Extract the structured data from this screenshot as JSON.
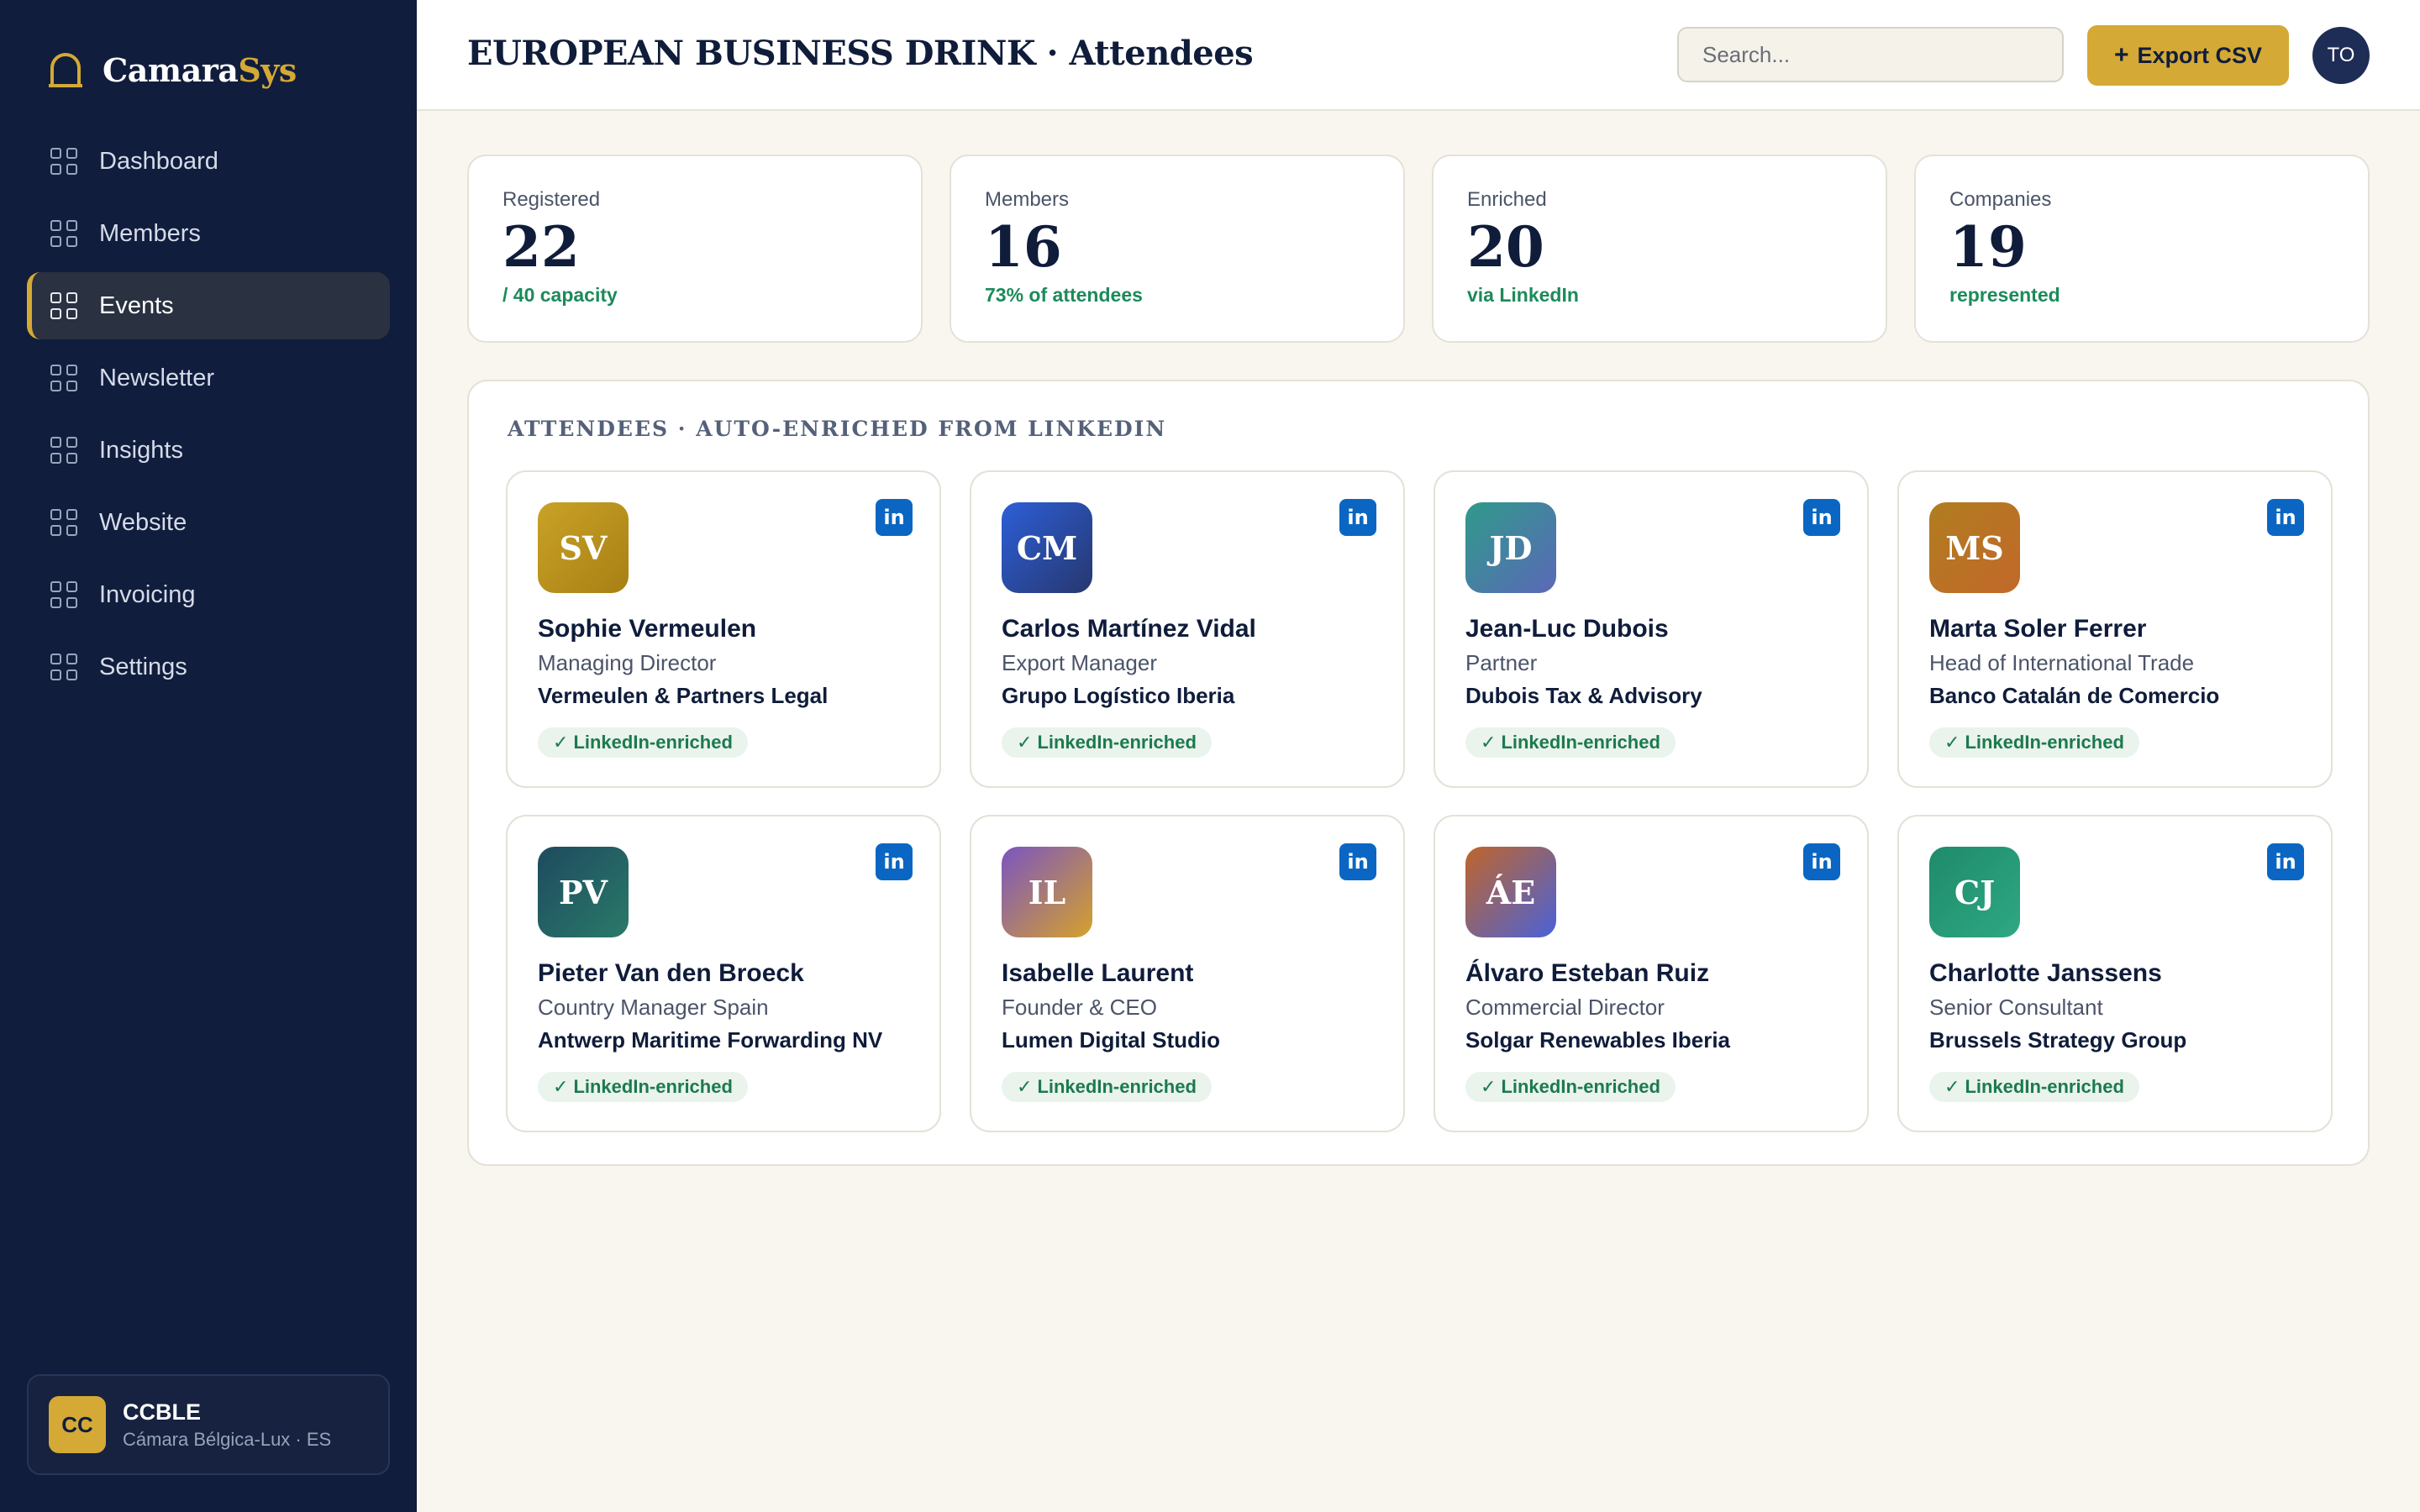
{
  "app": {
    "name_main": "Camara",
    "name_accent": "Sys",
    "logo_icon": "bell-icon",
    "accent_color": "#d4a935",
    "sidebar_color": "#111d3d"
  },
  "sidebar": {
    "items": [
      {
        "label": "Dashboard",
        "icon": "grid-icon",
        "active": false
      },
      {
        "label": "Members",
        "icon": "grid-icon",
        "active": false
      },
      {
        "label": "Events",
        "icon": "grid-icon",
        "active": true
      },
      {
        "label": "Newsletter",
        "icon": "grid-icon",
        "active": false
      },
      {
        "label": "Insights",
        "icon": "grid-icon",
        "active": false
      },
      {
        "label": "Website",
        "icon": "grid-icon",
        "active": false
      },
      {
        "label": "Invoicing",
        "icon": "grid-icon",
        "active": false
      },
      {
        "label": "Settings",
        "icon": "grid-icon",
        "active": false
      }
    ],
    "org": {
      "initials": "CC",
      "name": "CCBLE",
      "subtitle": "Cámara Bélgica-Lux · ES"
    }
  },
  "header": {
    "title": "EUROPEAN BUSINESS DRINK · Attendees",
    "search_placeholder": "Search...",
    "export_plus": "+",
    "export_label": "Export CSV",
    "user_initials": "TO"
  },
  "stats": [
    {
      "label": "Registered",
      "value": "22",
      "note": "/ 40 capacity"
    },
    {
      "label": "Members",
      "value": "16",
      "note": "73% of attendees"
    },
    {
      "label": "Enriched",
      "value": "20",
      "note": "via LinkedIn"
    },
    {
      "label": "Companies",
      "value": "19",
      "note": "represented"
    }
  ],
  "attendees_panel": {
    "title": "ATTENDEES · AUTO-ENRICHED FROM LINKEDIN",
    "linkedin_badge": "in",
    "enriched_check": "✓",
    "enriched_label": "LinkedIn-enriched",
    "attendees": [
      {
        "initials": "SV",
        "name": "Sophie Vermeulen",
        "role": "Managing Director",
        "company": "Vermeulen & Partners Legal",
        "gradient": [
          "#c9a227",
          "#a87f14"
        ]
      },
      {
        "initials": "CM",
        "name": "Carlos Martínez Vidal",
        "role": "Export Manager",
        "company": "Grupo Logístico Iberia",
        "gradient": [
          "#2c5fd8",
          "#27376e"
        ]
      },
      {
        "initials": "JD",
        "name": "Jean-Luc Dubois",
        "role": "Partner",
        "company": "Dubois Tax & Advisory",
        "gradient": [
          "#2f9a8a",
          "#5b68b8"
        ]
      },
      {
        "initials": "MS",
        "name": "Marta Soler Ferrer",
        "role": "Head of International Trade",
        "company": "Banco Catalán de Comercio",
        "gradient": [
          "#b07d1f",
          "#c2682a"
        ]
      },
      {
        "initials": "PV",
        "name": "Pieter Van den Broeck",
        "role": "Country Manager Spain",
        "company": "Antwerp Maritime Forwarding NV",
        "gradient": [
          "#1e4a5e",
          "#2a7a6a"
        ]
      },
      {
        "initials": "IL",
        "name": "Isabelle Laurent",
        "role": "Founder & CEO",
        "company": "Lumen Digital Studio",
        "gradient": [
          "#7a55c0",
          "#d6a12c"
        ]
      },
      {
        "initials": "ÁE",
        "name": "Álvaro Esteban Ruiz",
        "role": "Commercial Director",
        "company": "Solgar Renewables Iberia",
        "gradient": [
          "#c0652a",
          "#4a62d8"
        ]
      },
      {
        "initials": "CJ",
        "name": "Charlotte Janssens",
        "role": "Senior Consultant",
        "company": "Brussels Strategy Group",
        "gradient": [
          "#1f8a6a",
          "#2ea882"
        ]
      }
    ]
  }
}
